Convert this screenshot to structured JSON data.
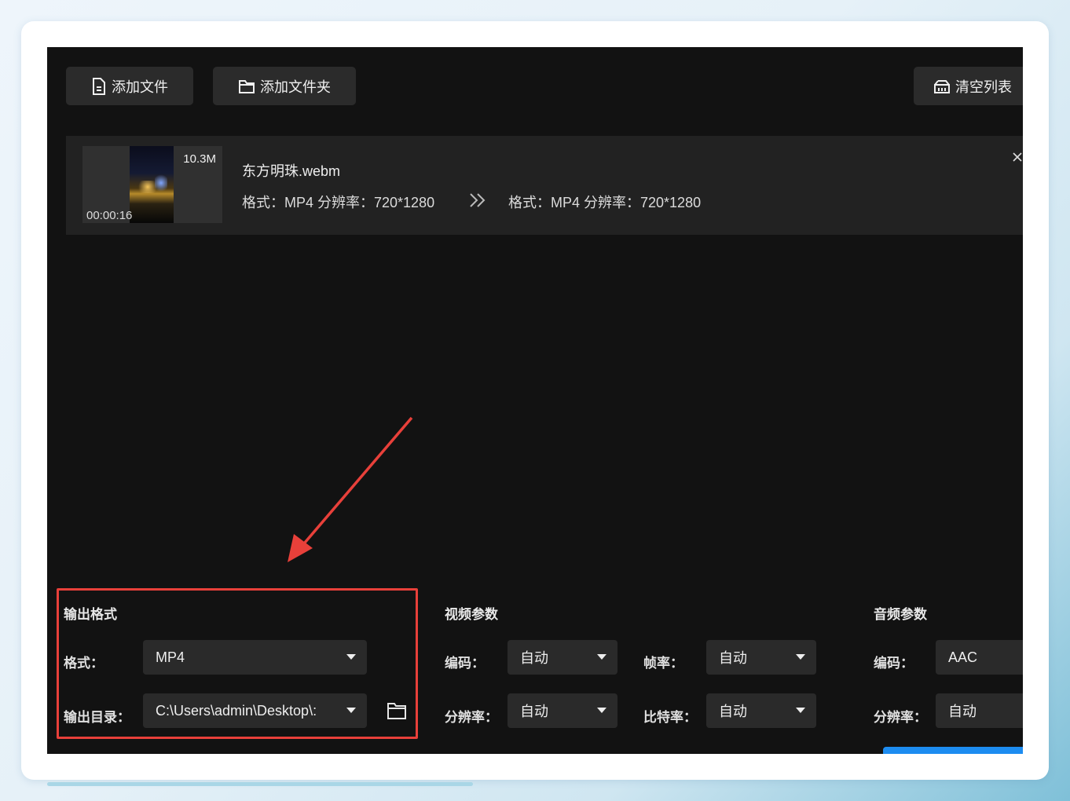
{
  "toolbar": {
    "add_file": "添加文件",
    "add_folder": "添加文件夹",
    "clear_list": "清空列表"
  },
  "file": {
    "size": "10.3M",
    "duration": "00:00:16",
    "name": "东方明珠.webm",
    "source_info": "格式：MP4   分辨率：720*1280",
    "target_info": "格式：MP4   分辨率：720*1280"
  },
  "output": {
    "title": "输出格式",
    "format_label": "格式：",
    "format_value": "MP4",
    "dir_label": "输出目录：",
    "dir_value": "C:\\Users\\admin\\Desktop\\:"
  },
  "video": {
    "title": "视频参数",
    "codec_label": "编码：",
    "codec_value": "自动",
    "fps_label": "帧率：",
    "fps_value": "自动",
    "res_label": "分辨率：",
    "res_value": "自动",
    "bitrate_label": "比特率：",
    "bitrate_value": "自动"
  },
  "audio": {
    "title": "音频参数",
    "codec_label": "编码：",
    "codec_value": "AAC",
    "res_label": "分辨率：",
    "res_value": "自动"
  },
  "colors": {
    "accent_red": "#e8403a",
    "accent_blue": "#1d8cf0",
    "app_bg": "#121212"
  },
  "icons": [
    "file-icon",
    "folder-icon",
    "clear-list-icon",
    "close-icon",
    "double-chevron-right-icon",
    "caret-down-icon",
    "folder-open-icon",
    "annotation-arrow"
  ]
}
